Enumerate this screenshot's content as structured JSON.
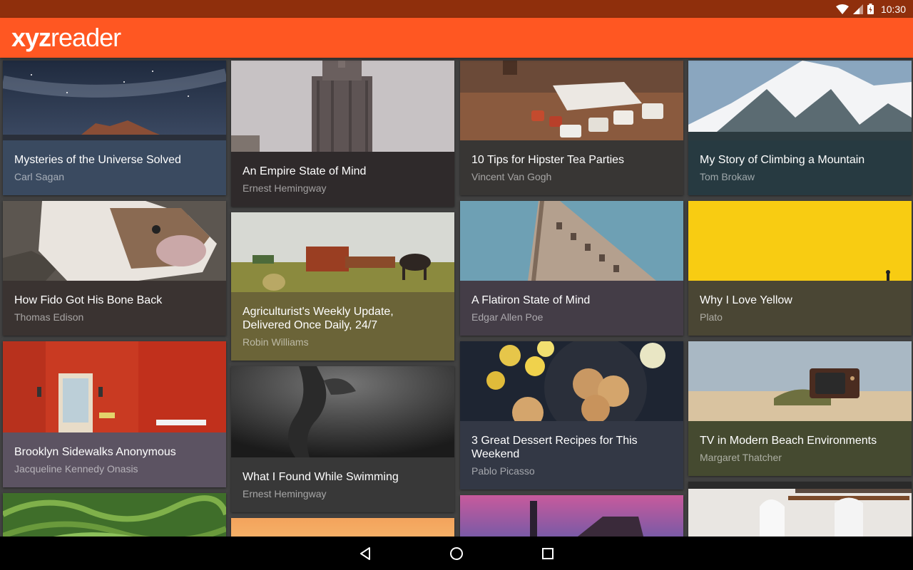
{
  "status_bar": {
    "time": "10:30"
  },
  "app_bar": {
    "logo_bold": "xyz",
    "logo_thin": "reader"
  },
  "articles": [
    {
      "title": "Mysteries of the Universe Solved",
      "author": "Carl Sagan",
      "color": "#3a4a60"
    },
    {
      "title": "An Empire State of Mind",
      "author": "Ernest Hemingway",
      "color": "#2f2a2b"
    },
    {
      "title": "10 Tips for Hipster Tea Parties",
      "author": "Vincent Van Gogh",
      "color": "#383634"
    },
    {
      "title": "My Story of Climbing a Mountain",
      "author": "Tom Brokaw",
      "color": "#273a41"
    },
    {
      "title": "How Fido Got His Bone Back",
      "author": "Thomas Edison",
      "color": "#3a3331"
    },
    {
      "title": "Agriculturist's Weekly Update, Delivered Once Daily, 24/7",
      "author": "Robin Williams",
      "color": "#6b6438"
    },
    {
      "title": "A Flatiron State of Mind",
      "author": "Edgar Allen Poe",
      "color": "#443d47"
    },
    {
      "title": "Why I Love Yellow",
      "author": "Plato",
      "color": "#4a4634"
    },
    {
      "title": "Brooklyn Sidewalks Anonymous",
      "author": "Jacqueline Kennedy Onasis",
      "color": "#5c5362"
    },
    {
      "title": "What I Found While Swimming",
      "author": "Ernest Hemingway",
      "color": "#383838"
    },
    {
      "title": "3 Great Dessert Recipes for This Weekend",
      "author": "Pablo Picasso",
      "color": "#333845"
    },
    {
      "title": "TV in Modern Beach Environments",
      "author": "Margaret Thatcher",
      "color": "#454a30"
    }
  ]
}
